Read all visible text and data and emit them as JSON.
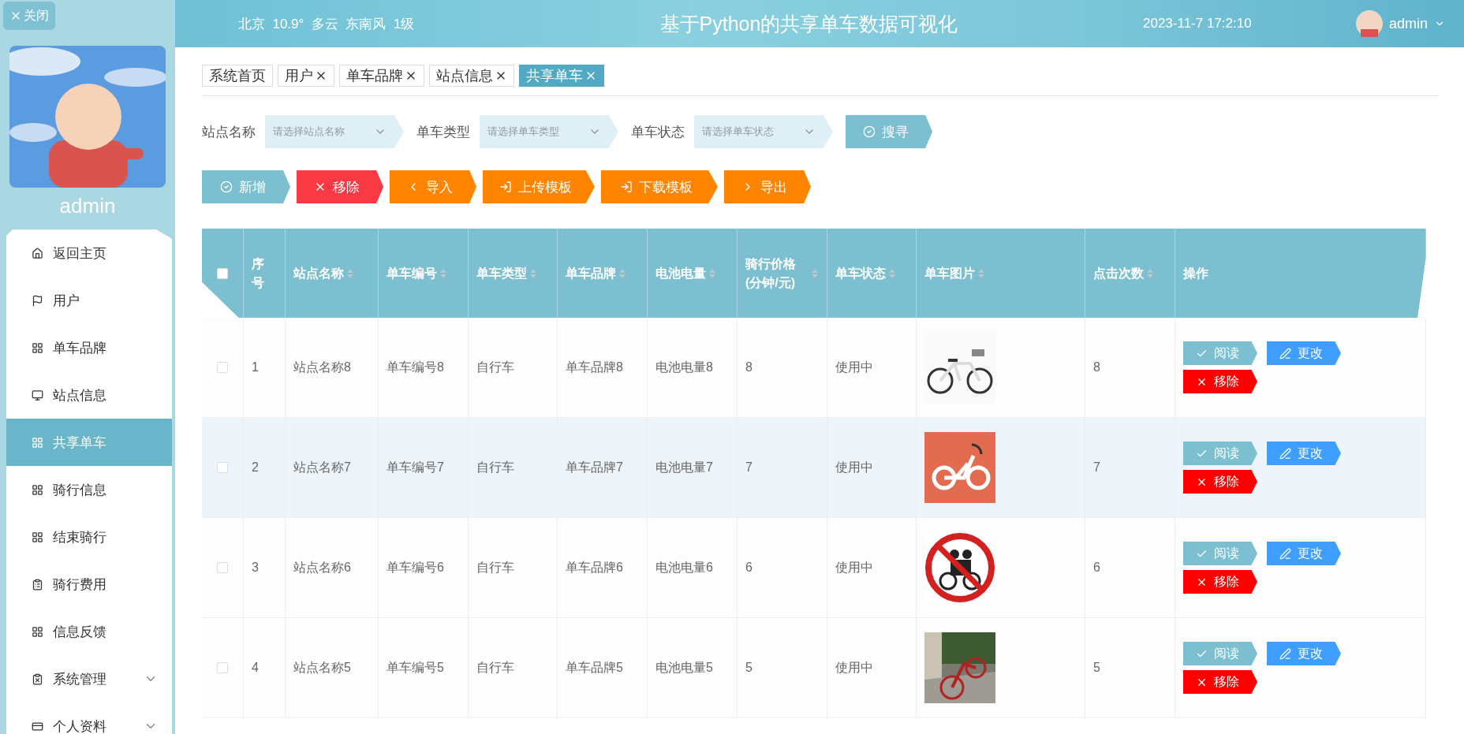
{
  "close_button": {
    "label": "关闭"
  },
  "sidebar": {
    "username": "admin",
    "avatar": {
      "kind": "picture"
    },
    "items": [
      {
        "label": "返回主页",
        "kind": "link",
        "selected": false
      },
      {
        "label": "用户",
        "kind": "link",
        "selected": false
      },
      {
        "label": "单车品牌",
        "kind": "link",
        "selected": false
      },
      {
        "label": "站点信息",
        "kind": "link",
        "selected": false
      },
      {
        "label": "共享单车",
        "kind": "link",
        "selected": true
      },
      {
        "label": "骑行信息",
        "kind": "link",
        "selected": false
      },
      {
        "label": "结束骑行",
        "kind": "link",
        "selected": false
      },
      {
        "label": "骑行费用",
        "kind": "link",
        "selected": false
      },
      {
        "label": "信息反馈",
        "kind": "link",
        "selected": false
      },
      {
        "label": "系统管理",
        "kind": "group",
        "selected": false,
        "expanded": false
      },
      {
        "label": "个人资料",
        "kind": "group",
        "selected": false,
        "expanded": false
      }
    ]
  },
  "header": {
    "weather": "北京  10.9°  多云  东南风  1级",
    "title": "基于Python的共享单车数据可视化",
    "datetime": "2023-11-7 17:2:10",
    "user": "admin"
  },
  "tabs": [
    {
      "label": "系统首页",
      "closable": false,
      "selected": false
    },
    {
      "label": "用户",
      "closable": true,
      "selected": false
    },
    {
      "label": "单车品牌",
      "closable": true,
      "selected": false
    },
    {
      "label": "站点信息",
      "closable": true,
      "selected": false
    },
    {
      "label": "共享单车",
      "closable": true,
      "selected": true
    }
  ],
  "filters": [
    {
      "label": "站点名称",
      "placeholder": "请选择站点名称"
    },
    {
      "label": "单车类型",
      "placeholder": "请选择单车类型"
    },
    {
      "label": "单车状态",
      "placeholder": "请选择单车状态"
    }
  ],
  "search_button": {
    "label": "搜寻"
  },
  "actions": [
    {
      "label": "新增",
      "kind": "primary"
    },
    {
      "label": "移除",
      "kind": "danger"
    },
    {
      "label": "导入",
      "kind": "warning"
    },
    {
      "label": "上传模板",
      "kind": "warning"
    },
    {
      "label": "下载模板",
      "kind": "warning"
    },
    {
      "label": "导出",
      "kind": "warning"
    }
  ],
  "table": {
    "select_all": {
      "checked": false
    },
    "columns": [
      {
        "label": "序号",
        "sortable": false
      },
      {
        "label": "站点名称",
        "sortable": true
      },
      {
        "label": "单车编号",
        "sortable": true
      },
      {
        "label": "单车类型",
        "sortable": true
      },
      {
        "label": "单车品牌",
        "sortable": true
      },
      {
        "label": "电池电量",
        "sortable": true
      },
      {
        "label": "骑行价格(分钟/元)",
        "sortable": true
      },
      {
        "label": "单车状态",
        "sortable": true
      },
      {
        "label": "单车图片",
        "sortable": true
      },
      {
        "label": "点击次数",
        "sortable": true
      },
      {
        "label": "操作",
        "sortable": false
      }
    ],
    "rows": [
      {
        "checked": false,
        "highlighted": false,
        "cells": [
          "1",
          "站点名称8",
          "单车编号8",
          "自行车",
          "单车品牌8",
          "电池电量8",
          "8",
          "使用中"
        ],
        "picture": {
          "kind": "picture"
        },
        "clicks": "8",
        "actions": [
          {
            "label": "阅读",
            "kind": "primary"
          },
          {
            "label": "更改",
            "kind": "info"
          },
          {
            "label": "移除",
            "kind": "danger"
          }
        ]
      },
      {
        "checked": false,
        "highlighted": true,
        "cells": [
          "2",
          "站点名称7",
          "单车编号7",
          "自行车",
          "单车品牌7",
          "电池电量7",
          "7",
          "使用中"
        ],
        "picture": {
          "kind": "picture"
        },
        "clicks": "7",
        "actions": [
          {
            "label": "阅读",
            "kind": "primary"
          },
          {
            "label": "更改",
            "kind": "info"
          },
          {
            "label": "移除",
            "kind": "danger"
          }
        ]
      },
      {
        "checked": false,
        "highlighted": false,
        "cells": [
          "3",
          "站点名称6",
          "单车编号6",
          "自行车",
          "单车品牌6",
          "电池电量6",
          "6",
          "使用中"
        ],
        "picture": {
          "kind": "picture"
        },
        "clicks": "6",
        "actions": [
          {
            "label": "阅读",
            "kind": "primary"
          },
          {
            "label": "更改",
            "kind": "info"
          },
          {
            "label": "移除",
            "kind": "danger"
          }
        ]
      },
      {
        "checked": false,
        "highlighted": false,
        "cells": [
          "4",
          "站点名称5",
          "单车编号5",
          "自行车",
          "单车品牌5",
          "电池电量5",
          "5",
          "使用中"
        ],
        "picture": {
          "kind": "picture"
        },
        "clicks": "5",
        "actions": [
          {
            "label": "阅读",
            "kind": "primary"
          },
          {
            "label": "更改",
            "kind": "info"
          },
          {
            "label": "移除",
            "kind": "danger"
          }
        ]
      }
    ]
  }
}
